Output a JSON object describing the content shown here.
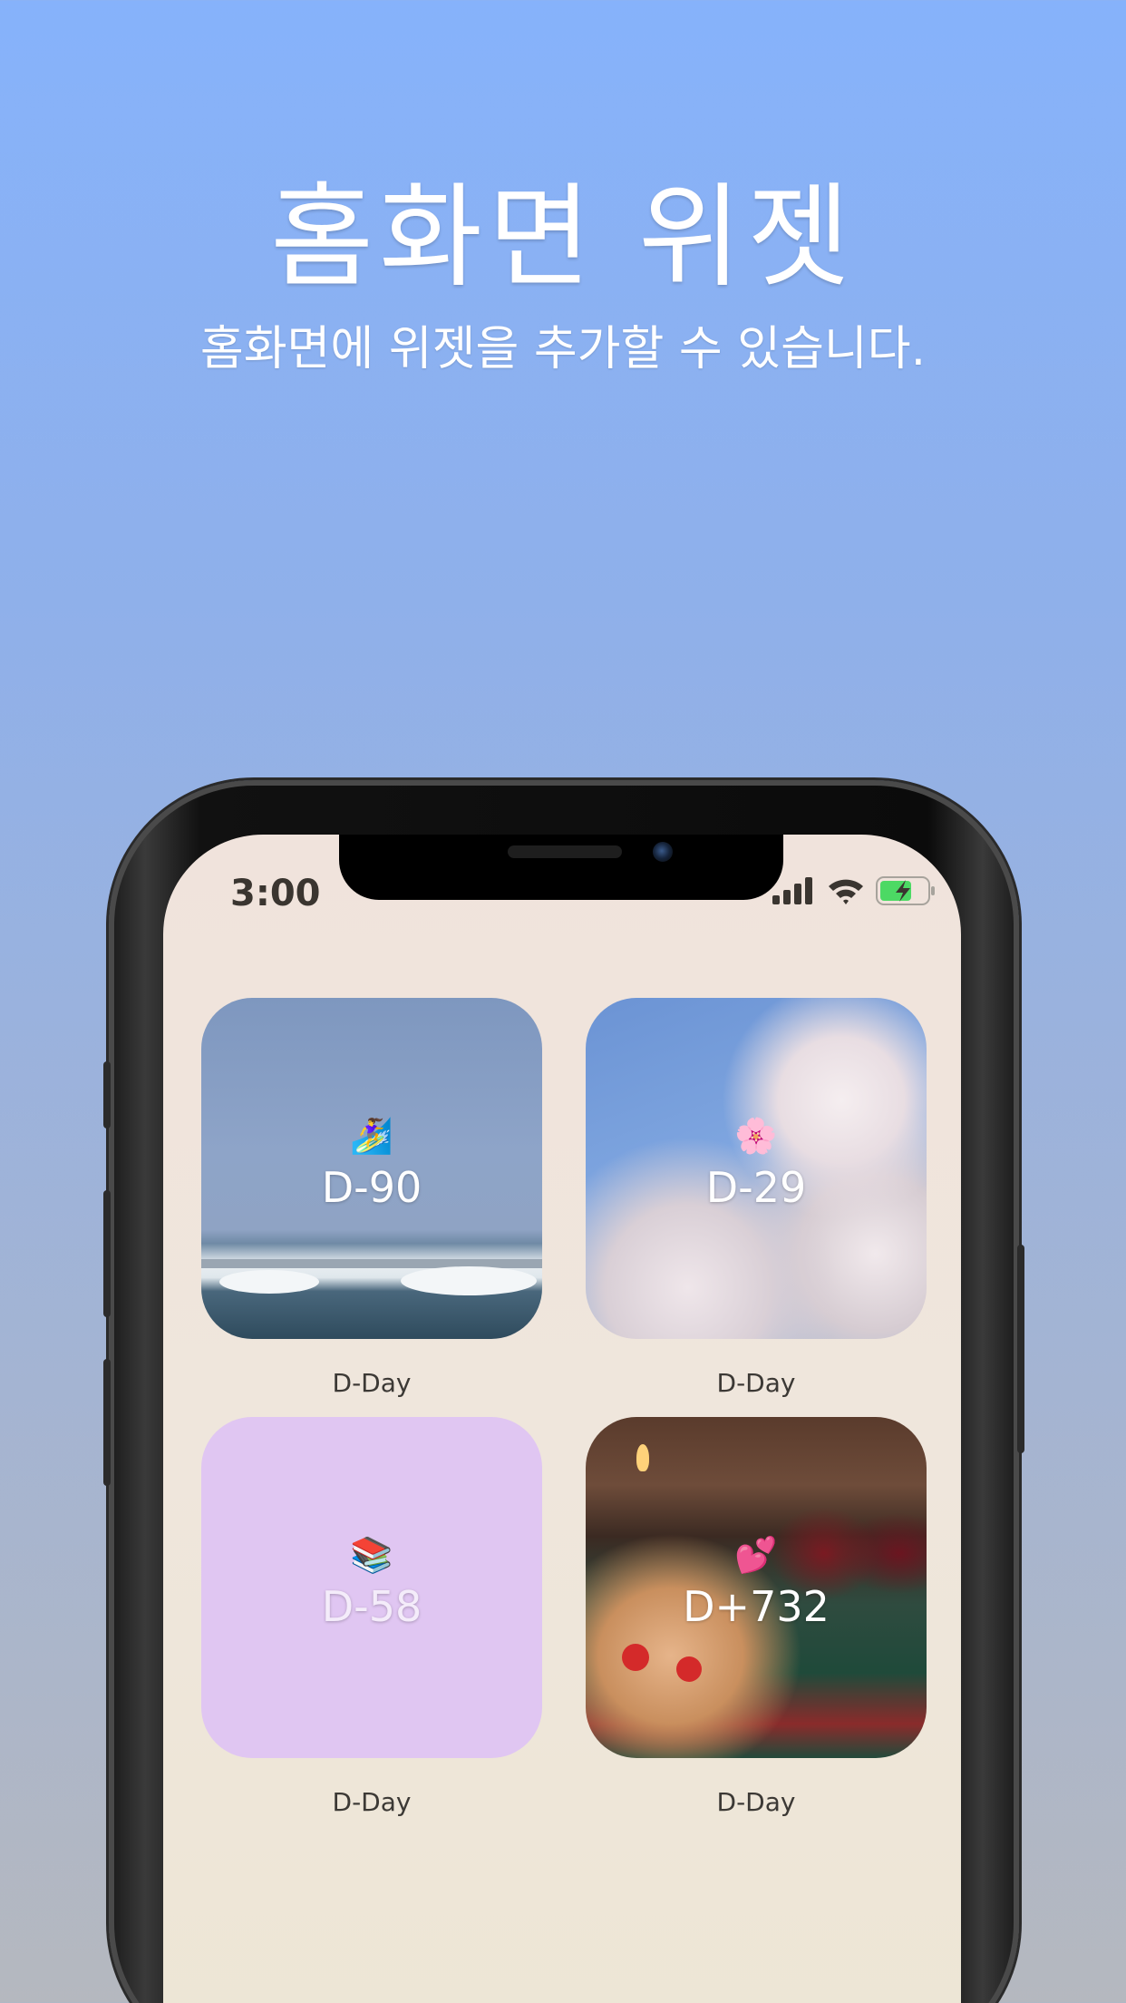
{
  "header": {
    "title": "홈화면 위젯",
    "subtitle": "홈화면에 위젯을 추가할 수 있습니다."
  },
  "status_bar": {
    "time": "3:00",
    "icons": [
      "cellular-signal-icon",
      "wifi-icon",
      "battery-charging-icon"
    ],
    "battery_color": "#4cd964"
  },
  "widgets": [
    {
      "emoji": "🏄‍♀️",
      "count": "D-90",
      "label": "D-Day",
      "background": "sea-photo"
    },
    {
      "emoji": "🌸",
      "count": "D-29",
      "label": "D-Day",
      "background": "cherry-blossom-photo"
    },
    {
      "emoji": "📚",
      "count": "D-58",
      "label": "D-Day",
      "background": "#e0c6f2"
    },
    {
      "emoji": "💕",
      "count": "D+732",
      "label": "D-Day",
      "background": "cake-photo"
    }
  ],
  "colors": {
    "background_top": "#86b2fb",
    "background_bottom": "#b5b8bf",
    "screen": "#f0e3dc",
    "widget_lilac": "#e0c6f2"
  }
}
